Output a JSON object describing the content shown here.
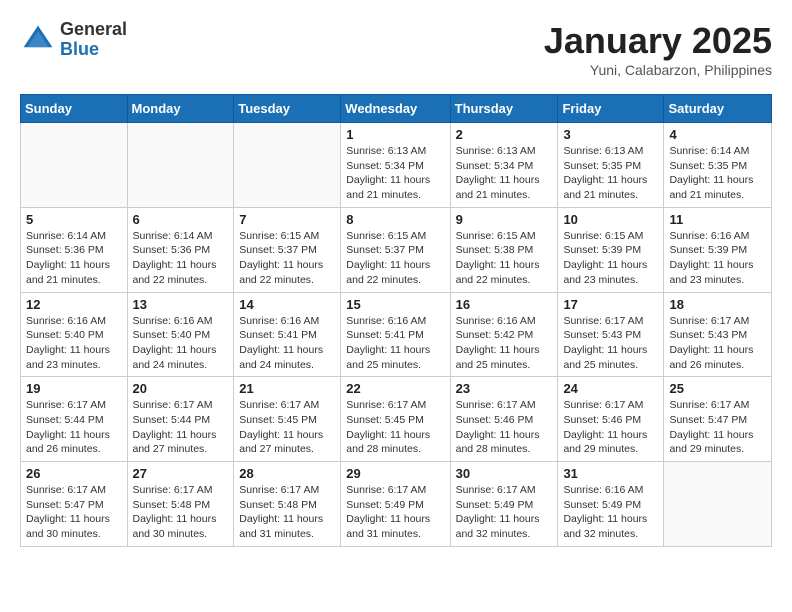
{
  "logo": {
    "general": "General",
    "blue": "Blue"
  },
  "header": {
    "month": "January 2025",
    "location": "Yuni, Calabarzon, Philippines"
  },
  "days_of_week": [
    "Sunday",
    "Monday",
    "Tuesday",
    "Wednesday",
    "Thursday",
    "Friday",
    "Saturday"
  ],
  "weeks": [
    [
      {
        "day": "",
        "info": ""
      },
      {
        "day": "",
        "info": ""
      },
      {
        "day": "",
        "info": ""
      },
      {
        "day": "1",
        "info": "Sunrise: 6:13 AM\nSunset: 5:34 PM\nDaylight: 11 hours\nand 21 minutes."
      },
      {
        "day": "2",
        "info": "Sunrise: 6:13 AM\nSunset: 5:34 PM\nDaylight: 11 hours\nand 21 minutes."
      },
      {
        "day": "3",
        "info": "Sunrise: 6:13 AM\nSunset: 5:35 PM\nDaylight: 11 hours\nand 21 minutes."
      },
      {
        "day": "4",
        "info": "Sunrise: 6:14 AM\nSunset: 5:35 PM\nDaylight: 11 hours\nand 21 minutes."
      }
    ],
    [
      {
        "day": "5",
        "info": "Sunrise: 6:14 AM\nSunset: 5:36 PM\nDaylight: 11 hours\nand 21 minutes."
      },
      {
        "day": "6",
        "info": "Sunrise: 6:14 AM\nSunset: 5:36 PM\nDaylight: 11 hours\nand 22 minutes."
      },
      {
        "day": "7",
        "info": "Sunrise: 6:15 AM\nSunset: 5:37 PM\nDaylight: 11 hours\nand 22 minutes."
      },
      {
        "day": "8",
        "info": "Sunrise: 6:15 AM\nSunset: 5:37 PM\nDaylight: 11 hours\nand 22 minutes."
      },
      {
        "day": "9",
        "info": "Sunrise: 6:15 AM\nSunset: 5:38 PM\nDaylight: 11 hours\nand 22 minutes."
      },
      {
        "day": "10",
        "info": "Sunrise: 6:15 AM\nSunset: 5:39 PM\nDaylight: 11 hours\nand 23 minutes."
      },
      {
        "day": "11",
        "info": "Sunrise: 6:16 AM\nSunset: 5:39 PM\nDaylight: 11 hours\nand 23 minutes."
      }
    ],
    [
      {
        "day": "12",
        "info": "Sunrise: 6:16 AM\nSunset: 5:40 PM\nDaylight: 11 hours\nand 23 minutes."
      },
      {
        "day": "13",
        "info": "Sunrise: 6:16 AM\nSunset: 5:40 PM\nDaylight: 11 hours\nand 24 minutes."
      },
      {
        "day": "14",
        "info": "Sunrise: 6:16 AM\nSunset: 5:41 PM\nDaylight: 11 hours\nand 24 minutes."
      },
      {
        "day": "15",
        "info": "Sunrise: 6:16 AM\nSunset: 5:41 PM\nDaylight: 11 hours\nand 25 minutes."
      },
      {
        "day": "16",
        "info": "Sunrise: 6:16 AM\nSunset: 5:42 PM\nDaylight: 11 hours\nand 25 minutes."
      },
      {
        "day": "17",
        "info": "Sunrise: 6:17 AM\nSunset: 5:43 PM\nDaylight: 11 hours\nand 25 minutes."
      },
      {
        "day": "18",
        "info": "Sunrise: 6:17 AM\nSunset: 5:43 PM\nDaylight: 11 hours\nand 26 minutes."
      }
    ],
    [
      {
        "day": "19",
        "info": "Sunrise: 6:17 AM\nSunset: 5:44 PM\nDaylight: 11 hours\nand 26 minutes."
      },
      {
        "day": "20",
        "info": "Sunrise: 6:17 AM\nSunset: 5:44 PM\nDaylight: 11 hours\nand 27 minutes."
      },
      {
        "day": "21",
        "info": "Sunrise: 6:17 AM\nSunset: 5:45 PM\nDaylight: 11 hours\nand 27 minutes."
      },
      {
        "day": "22",
        "info": "Sunrise: 6:17 AM\nSunset: 5:45 PM\nDaylight: 11 hours\nand 28 minutes."
      },
      {
        "day": "23",
        "info": "Sunrise: 6:17 AM\nSunset: 5:46 PM\nDaylight: 11 hours\nand 28 minutes."
      },
      {
        "day": "24",
        "info": "Sunrise: 6:17 AM\nSunset: 5:46 PM\nDaylight: 11 hours\nand 29 minutes."
      },
      {
        "day": "25",
        "info": "Sunrise: 6:17 AM\nSunset: 5:47 PM\nDaylight: 11 hours\nand 29 minutes."
      }
    ],
    [
      {
        "day": "26",
        "info": "Sunrise: 6:17 AM\nSunset: 5:47 PM\nDaylight: 11 hours\nand 30 minutes."
      },
      {
        "day": "27",
        "info": "Sunrise: 6:17 AM\nSunset: 5:48 PM\nDaylight: 11 hours\nand 30 minutes."
      },
      {
        "day": "28",
        "info": "Sunrise: 6:17 AM\nSunset: 5:48 PM\nDaylight: 11 hours\nand 31 minutes."
      },
      {
        "day": "29",
        "info": "Sunrise: 6:17 AM\nSunset: 5:49 PM\nDaylight: 11 hours\nand 31 minutes."
      },
      {
        "day": "30",
        "info": "Sunrise: 6:17 AM\nSunset: 5:49 PM\nDaylight: 11 hours\nand 32 minutes."
      },
      {
        "day": "31",
        "info": "Sunrise: 6:16 AM\nSunset: 5:49 PM\nDaylight: 11 hours\nand 32 minutes."
      },
      {
        "day": "",
        "info": ""
      }
    ]
  ]
}
